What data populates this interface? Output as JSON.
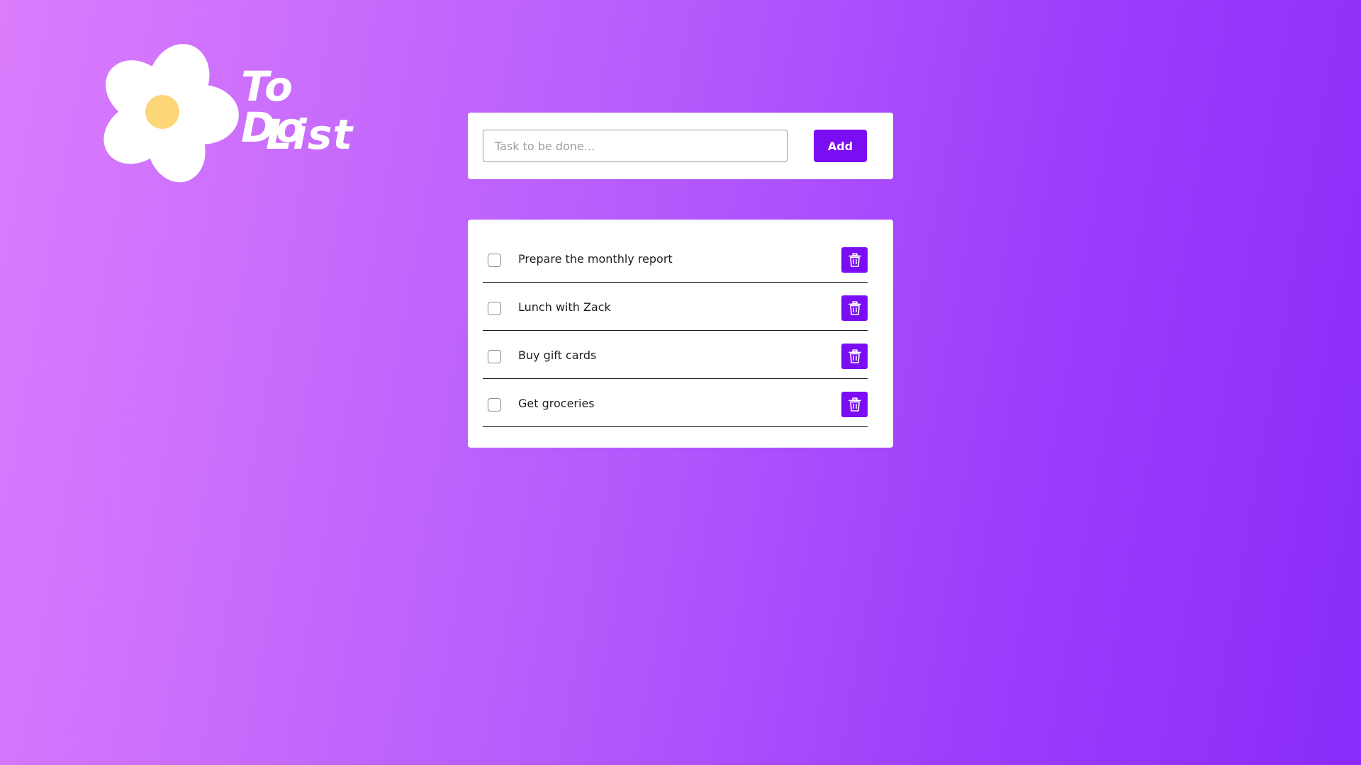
{
  "app": {
    "title_line_1": "To Do",
    "title_line_2": "List",
    "logo_icon": "flower-icon"
  },
  "colors": {
    "accent": "#7b0df2",
    "flower_petal": "#ffffff",
    "flower_center": "#fed67a",
    "background_start": "#dc7dfd",
    "background_end": "#8a2cfa"
  },
  "input_card": {
    "task_input_value": "",
    "task_input_placeholder": "Task to be done...",
    "add_label": "Add"
  },
  "tasks": [
    {
      "label": "Prepare the monthly report",
      "checked": false,
      "delete_icon": "trash-icon"
    },
    {
      "label": "Lunch with Zack",
      "checked": false,
      "delete_icon": "trash-icon"
    },
    {
      "label": "Buy gift cards",
      "checked": false,
      "delete_icon": "trash-icon"
    },
    {
      "label": "Get groceries",
      "checked": false,
      "delete_icon": "trash-icon"
    }
  ]
}
